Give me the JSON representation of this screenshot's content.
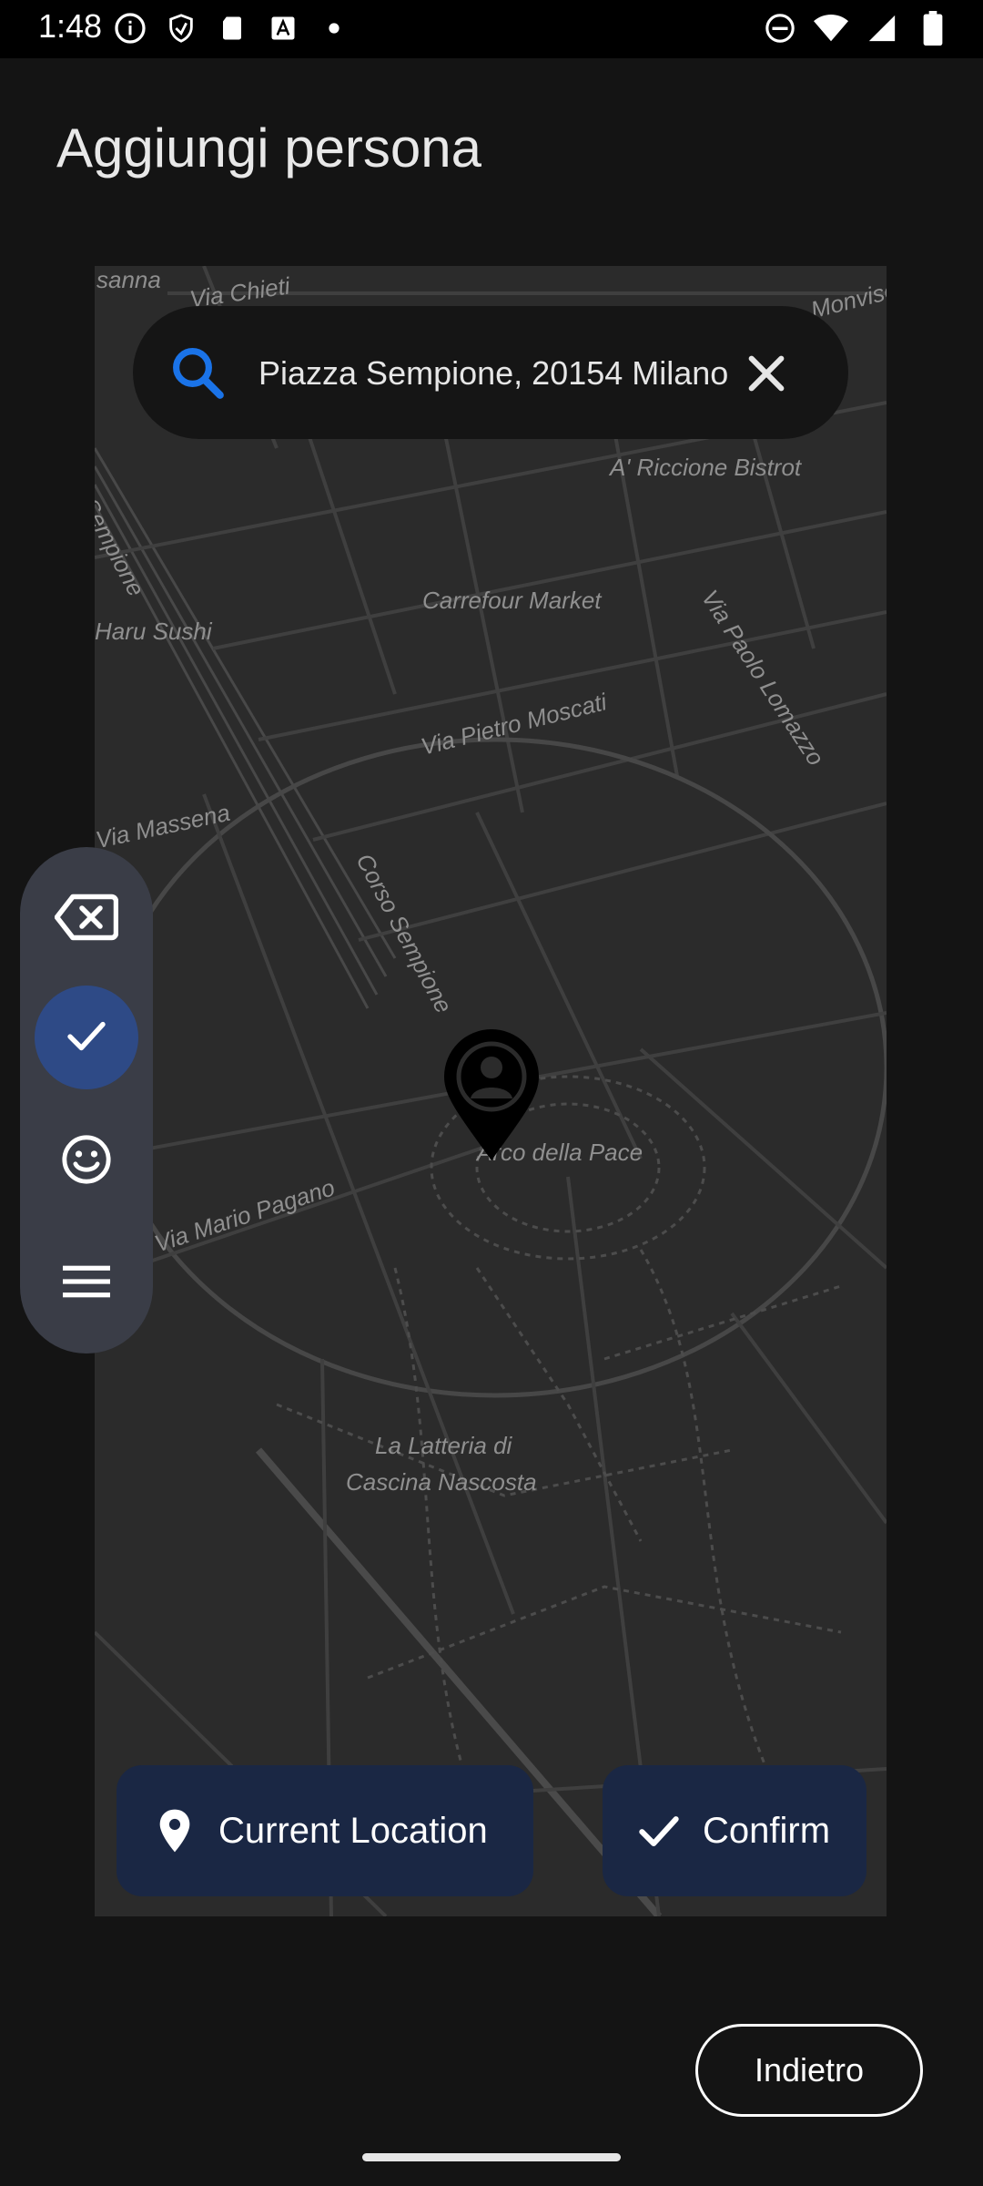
{
  "status_bar": {
    "time": "1:48"
  },
  "page": {
    "title": "Aggiungi persona"
  },
  "search": {
    "value": "Piazza Sempione, 20154 Milano"
  },
  "map": {
    "labels": [
      "sanna",
      "Via Chieti",
      "Monviso",
      "A' Riccione Bistrot",
      "Via Paolo Lomazzo",
      "Sempione",
      "Haru Sushi",
      "Carrefour Market",
      "Via Pietro Moscati",
      "Via Massena",
      "Corso Sempione",
      "Arco della Pace",
      "Via Mario Pagano",
      "La Latteria di",
      "Cascina Nascosta"
    ]
  },
  "side_rail": {
    "items": [
      "backspace-icon",
      "check-icon",
      "emoji-icon",
      "menu-icon"
    ],
    "selected": "check-icon"
  },
  "buttons": {
    "current_location": "Current Location",
    "confirm": "Confirm",
    "back": "Indietro"
  },
  "colors": {
    "accent_blue": "#1a73e8",
    "button_bg": "#1a2744",
    "rail_bg": "#3a3d47",
    "rail_selected": "#2e4a86"
  }
}
